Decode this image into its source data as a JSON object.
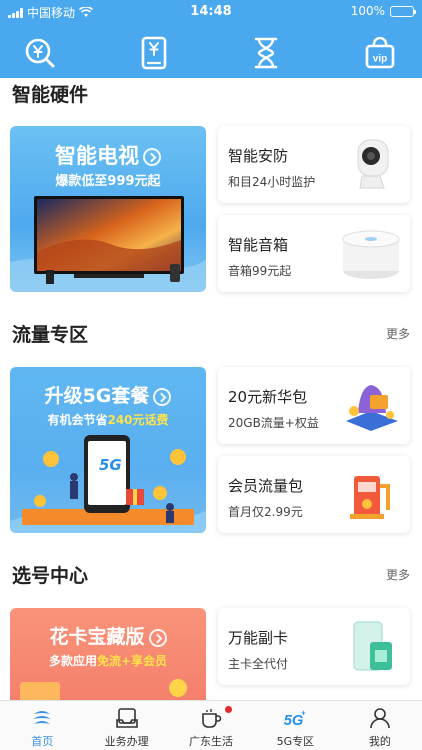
{
  "status_bar": {
    "carrier": "中国移动",
    "time": "14:48",
    "battery": "100%"
  },
  "toolbar": {
    "icons": [
      "search-coin-icon",
      "yuan-phone-icon",
      "hourglass-icon",
      "vip-bag-icon"
    ]
  },
  "sections": {
    "hardware": {
      "title": "智能硬件",
      "banner": {
        "title": "智能电视",
        "subtitle": "爆款低至999元起"
      },
      "cards": [
        {
          "title": "智能安防",
          "subtitle": "和目24小时监护"
        },
        {
          "title": "智能音箱",
          "subtitle": "音箱99元起"
        }
      ]
    },
    "traffic": {
      "title": "流量专区",
      "more": "更多",
      "banner": {
        "title": "升级5G套餐",
        "subtitle_prefix": "有机会节省",
        "subtitle_highlight": "240元话费",
        "badge": "5G"
      },
      "cards": [
        {
          "title": "20元新华包",
          "subtitle": "20GB流量+权益"
        },
        {
          "title": "会员流量包",
          "subtitle": "首月仅2.99元"
        }
      ]
    },
    "number": {
      "title": "选号中心",
      "more": "更多",
      "banner": {
        "title": "花卡宝藏版",
        "subtitle_prefix": "多款应用",
        "subtitle_highlight": "免流+享会员"
      },
      "cards": [
        {
          "title": "万能副卡",
          "subtitle": "主卡全代付"
        }
      ]
    }
  },
  "tabs": [
    {
      "label": "首页",
      "active": true
    },
    {
      "label": "业务办理",
      "active": false
    },
    {
      "label": "广东生活",
      "active": false,
      "badge": true
    },
    {
      "label": "5G专区",
      "active": false
    },
    {
      "label": "我的",
      "active": false
    }
  ],
  "colors": {
    "brand_blue": "#4aa8ee",
    "active_tab": "#3a8ee6",
    "highlight_yellow": "#ffe24a",
    "badge_red": "#e8292b"
  }
}
